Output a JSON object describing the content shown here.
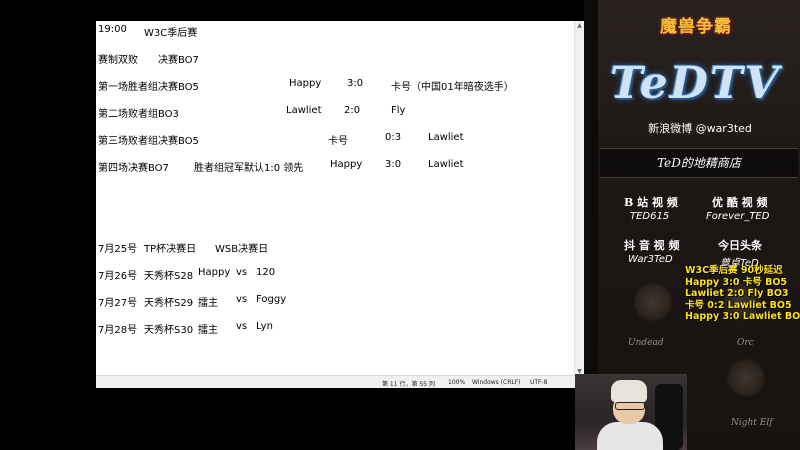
{
  "notepad": {
    "lines": [
      {
        "a": "19:00",
        "b": "W3C季后赛"
      },
      {
        "a": "赛制双败",
        "b": "决赛BO7"
      },
      {
        "a": "第一场胜者组决赛BO5",
        "p1": "Happy",
        "score": "3:0",
        "p2": "卡号（中国01年暗夜选手）"
      },
      {
        "a": "第二场败者组BO3",
        "p1": "Lawliet",
        "score": "2:0",
        "p2": "Fly"
      },
      {
        "a": "第三场败者组决赛BO5",
        "p1": "卡号",
        "score": "0:3",
        "p2": "Lawliet"
      },
      {
        "a": "第四场决赛BO7",
        "note": "胜者组冠军默认1:0 领先",
        "p1": "Happy",
        "score": "3:0",
        "p2": "Lawliet"
      },
      {
        "a": "7月25号",
        "b": "TP杯决赛日",
        "c": "WSB决赛日"
      },
      {
        "a": "7月26号",
        "b": "天秀杯S28",
        "p1": "Happy",
        "vs": "vs",
        "p2": "120"
      },
      {
        "a": "7月27号",
        "b": "天秀杯S29",
        "p1": "擂主",
        "vs": "vs",
        "p2": "Foggy"
      },
      {
        "a": "7月28号",
        "b": "天秀杯S30",
        "p1": "擂主",
        "vs": "vs",
        "p2": "Lyn"
      }
    ],
    "status": {
      "position": "第 11 行，第 55 列",
      "zoom": "100%",
      "eol": "Windows (CRLF)",
      "encoding": "UTF-8"
    }
  },
  "panel": {
    "game_logo": "魔兽争霸",
    "brand": "TeDTV",
    "weibo": "新浪微博 @war3ted",
    "shop": "TeD的地精商店",
    "social": [
      {
        "label": "B 站 视 频",
        "value": "TED615"
      },
      {
        "label": "优 酷 视 频",
        "value": "Forever_TED"
      },
      {
        "label": "抖 音 视 频",
        "value": "War3TeD"
      },
      {
        "label": "今日头条",
        "value": "曾卓TeD"
      }
    ],
    "races": [
      "Undead",
      "Orc",
      "Night Elf"
    ],
    "results": [
      "W3C季后赛 90秒延迟",
      "Happy 3:0 卡号 BO5",
      "Lawliet 2:0 Fly  BO3",
      "卡号 0:2 Lawliet BO5",
      "Happy 3:0 Lawliet BO7"
    ]
  }
}
